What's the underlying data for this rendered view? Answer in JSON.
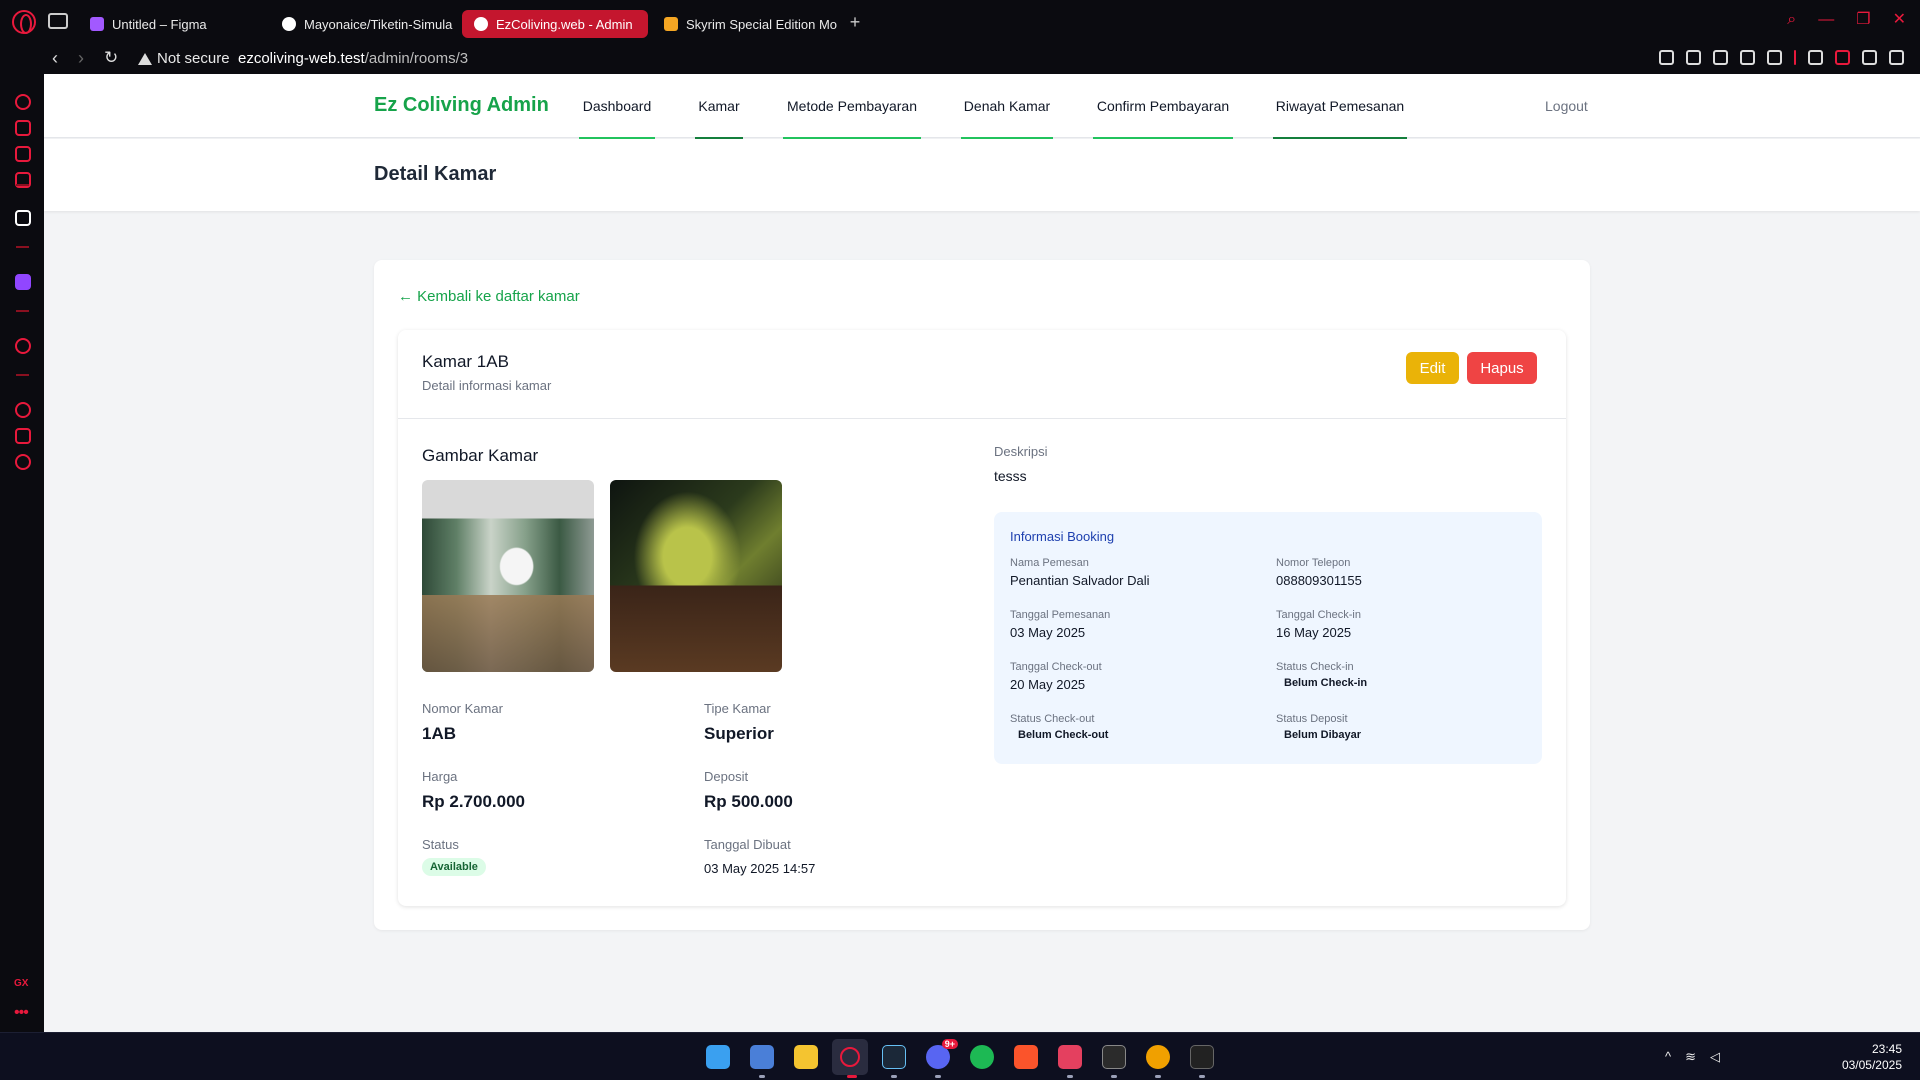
{
  "browser": {
    "tabs": [
      {
        "title": "Untitled – Figma",
        "favicon_color": "#a259ff"
      },
      {
        "title": "Mayonaice/Tiketin-Simula",
        "favicon_color": "#ffffff"
      },
      {
        "title": "EzColiving.web - Admin",
        "favicon_color": "#ffffff"
      },
      {
        "title": "Skyrim Special Edition Mo",
        "favicon_color": "#f5a623"
      }
    ],
    "new_tab": "+",
    "security": "Not secure",
    "url_host": "ezcoliving-web.test",
    "url_path": "/admin/rooms/3",
    "accent": "#e8193c"
  },
  "sidebar": {
    "gx_label": "GX",
    "more": "•••"
  },
  "nav": {
    "brand": "Ez Coliving Admin",
    "links": [
      {
        "label": "Dashboard"
      },
      {
        "label": "Kamar"
      },
      {
        "label": "Metode Pembayaran"
      },
      {
        "label": "Denah Kamar"
      },
      {
        "label": "Confirm Pembayaran"
      },
      {
        "label": "Riwayat Pemesanan"
      }
    ],
    "logout": "Logout"
  },
  "page": {
    "title": "Detail Kamar",
    "back_link": "← Kembali ke daftar kamar"
  },
  "room": {
    "title": "Kamar 1AB",
    "subtitle": "Detail informasi kamar",
    "edit_label": "Edit",
    "delete_label": "Hapus",
    "gallery_title": "Gambar Kamar",
    "fields": {
      "nomor_label": "Nomor Kamar",
      "nomor_value": "1AB",
      "tipe_label": "Tipe Kamar",
      "tipe_value": "Superior",
      "harga_label": "Harga",
      "harga_value": "Rp 2.700.000",
      "deposit_label": "Deposit",
      "deposit_value": "Rp 500.000",
      "status_label": "Status",
      "status_value": "Available",
      "created_label": "Tanggal Dibuat",
      "created_value": "03 May 2025 14:57"
    },
    "description_label": "Deskripsi",
    "description_value": "tesss"
  },
  "booking": {
    "title": "Informasi Booking",
    "nama_label": "Nama Pemesan",
    "nama_value": "Penantian Salvador Dali",
    "telp_label": "Nomor Telepon",
    "telp_value": "088809301155",
    "tgl_pesan_label": "Tanggal Pemesanan",
    "tgl_pesan_value": "03 May 2025",
    "checkin_label": "Tanggal Check-in",
    "checkin_value": "16 May 2025",
    "checkout_label": "Tanggal Check-out",
    "checkout_value": "20 May 2025",
    "status_checkin_label": "Status Check-in",
    "status_checkin_value": "Belum Check-in",
    "status_checkout_label": "Status Check-out",
    "status_checkout_value": "Belum Check-out",
    "status_deposit_label": "Status Deposit",
    "status_deposit_value": "Belum Dibayar"
  },
  "taskbar": {
    "time": "23:45",
    "date": "03/05/2025",
    "discord_badge": "9+"
  },
  "colors": {
    "brand_green": "#16a34a",
    "edit_yellow": "#eab308",
    "delete_red": "#ef4444",
    "booking_bg": "#eff6ff"
  }
}
